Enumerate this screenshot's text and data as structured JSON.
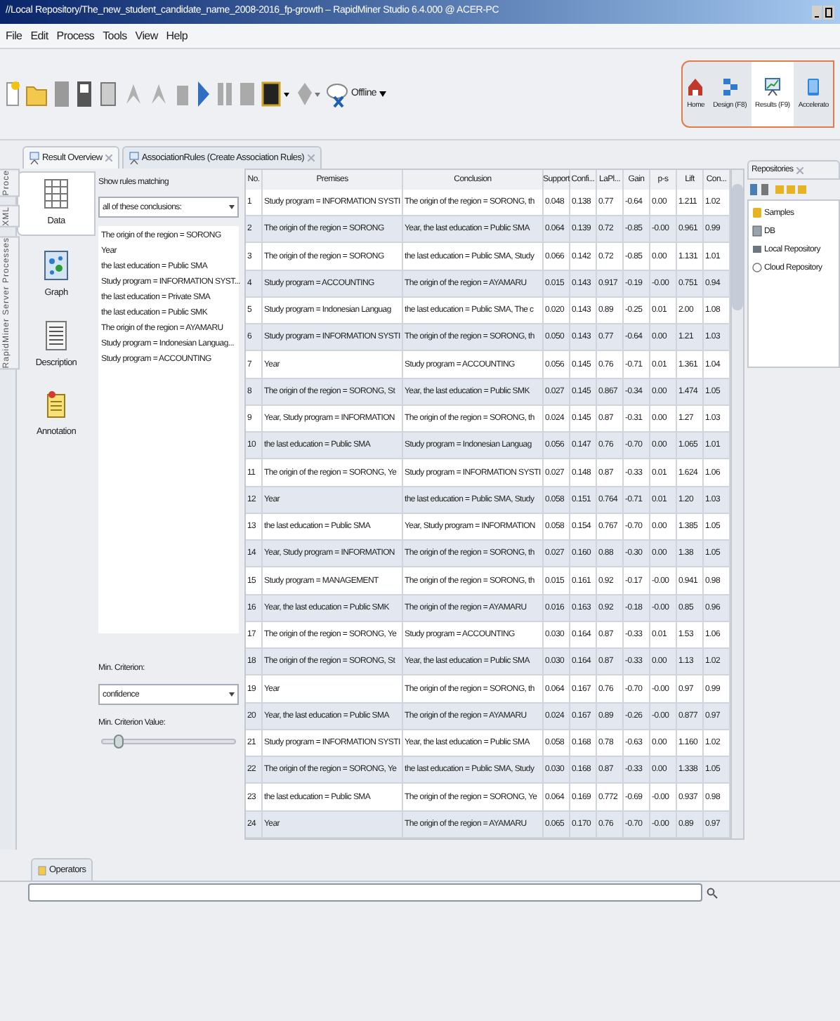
{
  "window": {
    "title": "//Local Repository/The_new_student_candidate_name_2008-2016_fp-growth – RapidMiner Studio 6.4.000 @ ACER-PC"
  },
  "menu": [
    "File",
    "Edit",
    "Process",
    "Tools",
    "View",
    "Help"
  ],
  "toolbar": {
    "connection": "Offline"
  },
  "perspectives": [
    {
      "label": "Home",
      "kind": "home",
      "selected": false
    },
    {
      "label": "Design (F8)",
      "kind": "design",
      "selected": false
    },
    {
      "label": "Results (F9)",
      "kind": "results",
      "selected": true
    },
    {
      "label": "Accelerato",
      "kind": "accelerator",
      "selected": false
    }
  ],
  "tabs": [
    {
      "label": "Result Overview",
      "selected": false
    },
    {
      "label": "AssociationRules (Create Association Rules)",
      "selected": true
    }
  ],
  "side_tabs": [
    "Proce",
    "XML",
    "RapidMiner Server Processes"
  ],
  "views": [
    {
      "label": "Data",
      "kind": "table",
      "selected": true
    },
    {
      "label": "Graph",
      "kind": "graph",
      "selected": false
    },
    {
      "label": "Description",
      "kind": "description",
      "selected": false
    },
    {
      "label": "Annotation",
      "kind": "annotation",
      "selected": false
    }
  ],
  "filter": {
    "label": "Show rules matching",
    "mode": "all of these conclusions:",
    "conclusions": [
      "The origin of the region = SORONG",
      "Year",
      "the last education = Public SMA",
      "Study program = INFORMATION SYST...",
      "the last education = Private SMA",
      "the last education = Public SMK",
      "The origin of the region = AYAMARU",
      "Study program = Indonesian Languag...",
      "Study program = ACCOUNTING"
    ],
    "min_criterion_label": "Min. Criterion:",
    "min_criterion": "confidence",
    "min_value_label": "Min. Criterion Value:",
    "slider": {
      "level": 0.12
    }
  },
  "table": {
    "columns": [
      "No.",
      "Premises",
      "Conclusion",
      "Support",
      "Confi...",
      "LaPl...",
      "Gain",
      "p-s",
      "Lift",
      "Con..."
    ],
    "rows": [
      [
        "1",
        "Study program = INFORMATION SYSTI",
        "The origin of the region = SORONG, th",
        "0.048",
        "0.138",
        "0.77",
        "-0.64",
        "0.00",
        "1.211",
        "1.02"
      ],
      [
        "2",
        "The origin of the region = SORONG",
        "Year, the last education = Public SMA",
        "0.064",
        "0.139",
        "0.72",
        "-0.85",
        "-0.00",
        "0.961",
        "0.99"
      ],
      [
        "3",
        "The origin of the region = SORONG",
        "the last education = Public SMA, Study",
        "0.066",
        "0.142",
        "0.72",
        "-0.85",
        "0.00",
        "1.131",
        "1.01"
      ],
      [
        "4",
        "Study program = ACCOUNTING",
        "The origin of the region = AYAMARU",
        "0.015",
        "0.143",
        "0.917",
        "-0.19",
        "-0.00",
        "0.751",
        "0.94"
      ],
      [
        "5",
        "Study program = Indonesian Languag",
        "the last education = Public SMA, The c",
        "0.020",
        "0.143",
        "0.89",
        "-0.25",
        "0.01",
        "2.00",
        "1.08"
      ],
      [
        "6",
        "Study program = INFORMATION SYSTI",
        "The origin of the region = SORONG, th",
        "0.050",
        "0.143",
        "0.77",
        "-0.64",
        "0.00",
        "1.21",
        "1.03"
      ],
      [
        "7",
        "Year",
        "Study program = ACCOUNTING",
        "0.056",
        "0.145",
        "0.76",
        "-0.71",
        "0.01",
        "1.361",
        "1.04"
      ],
      [
        "8",
        "The origin of the region = SORONG, St",
        "Year, the last education = Public SMK",
        "0.027",
        "0.145",
        "0.867",
        "-0.34",
        "0.00",
        "1.474",
        "1.05"
      ],
      [
        "9",
        "Year, Study program = INFORMATION",
        "The origin of the region = SORONG, th",
        "0.024",
        "0.145",
        "0.87",
        "-0.31",
        "0.00",
        "1.27",
        "1.03"
      ],
      [
        "10",
        "the last education = Public SMA",
        "Study program = Indonesian Languag",
        "0.056",
        "0.147",
        "0.76",
        "-0.70",
        "0.00",
        "1.065",
        "1.01"
      ],
      [
        "11",
        "The origin of the region = SORONG, Ye",
        "Study program = INFORMATION SYSTI",
        "0.027",
        "0.148",
        "0.87",
        "-0.33",
        "0.01",
        "1.624",
        "1.06"
      ],
      [
        "12",
        "Year",
        "the last education = Public SMA, Study",
        "0.058",
        "0.151",
        "0.764",
        "-0.71",
        "0.01",
        "1.20",
        "1.03"
      ],
      [
        "13",
        "the last education = Public SMA",
        "Year, Study program = INFORMATION",
        "0.058",
        "0.154",
        "0.767",
        "-0.70",
        "0.00",
        "1.385",
        "1.05"
      ],
      [
        "14",
        "Year, Study program = INFORMATION",
        "The origin of the region = SORONG, th",
        "0.027",
        "0.160",
        "0.88",
        "-0.30",
        "0.00",
        "1.38",
        "1.05"
      ],
      [
        "15",
        "Study program = MANAGEMENT",
        "The origin of the region = SORONG, th",
        "0.015",
        "0.161",
        "0.92",
        "-0.17",
        "-0.00",
        "0.941",
        "0.98"
      ],
      [
        "16",
        "Year, the last education = Public SMK",
        "The origin of the region = AYAMARU",
        "0.016",
        "0.163",
        "0.92",
        "-0.18",
        "-0.00",
        "0.85",
        "0.96"
      ],
      [
        "17",
        "The origin of the region = SORONG, Ye",
        "Study program = ACCOUNTING",
        "0.030",
        "0.164",
        "0.87",
        "-0.33",
        "0.01",
        "1.53",
        "1.06"
      ],
      [
        "18",
        "The origin of the region = SORONG, St",
        "Year, the last education = Public SMA",
        "0.030",
        "0.164",
        "0.87",
        "-0.33",
        "0.00",
        "1.13",
        "1.02"
      ],
      [
        "19",
        "Year",
        "The origin of the region = SORONG, th",
        "0.064",
        "0.167",
        "0.76",
        "-0.70",
        "-0.00",
        "0.97",
        "0.99"
      ],
      [
        "20",
        "Year, the last education = Public SMA",
        "The origin of the region = AYAMARU",
        "0.024",
        "0.167",
        "0.89",
        "-0.26",
        "-0.00",
        "0.877",
        "0.97"
      ],
      [
        "21",
        "Study program = INFORMATION SYSTI",
        "Year, the last education = Public SMA",
        "0.058",
        "0.168",
        "0.78",
        "-0.63",
        "0.00",
        "1.160",
        "1.02"
      ],
      [
        "22",
        "The origin of the region = SORONG, Ye",
        "the last education = Public SMA, Study",
        "0.030",
        "0.168",
        "0.87",
        "-0.33",
        "0.00",
        "1.338",
        "1.05"
      ],
      [
        "23",
        "the last education = Public SMA",
        "The origin of the region = SORONG, Ye",
        "0.064",
        "0.169",
        "0.772",
        "-0.69",
        "-0.00",
        "0.937",
        "0.98"
      ],
      [
        "24",
        "Year",
        "The origin of the region = AYAMARU",
        "0.065",
        "0.170",
        "0.76",
        "-0.70",
        "-0.00",
        "0.89",
        "0.97"
      ]
    ]
  },
  "repositories": {
    "title": "Repositories",
    "items": [
      {
        "label": "Samples",
        "kind": "folder"
      },
      {
        "label": "DB",
        "kind": "database"
      },
      {
        "label": "Local Repository",
        "kind": "local"
      },
      {
        "label": "Cloud Repository",
        "kind": "cloud"
      }
    ]
  },
  "operators": {
    "title": "Operators"
  }
}
